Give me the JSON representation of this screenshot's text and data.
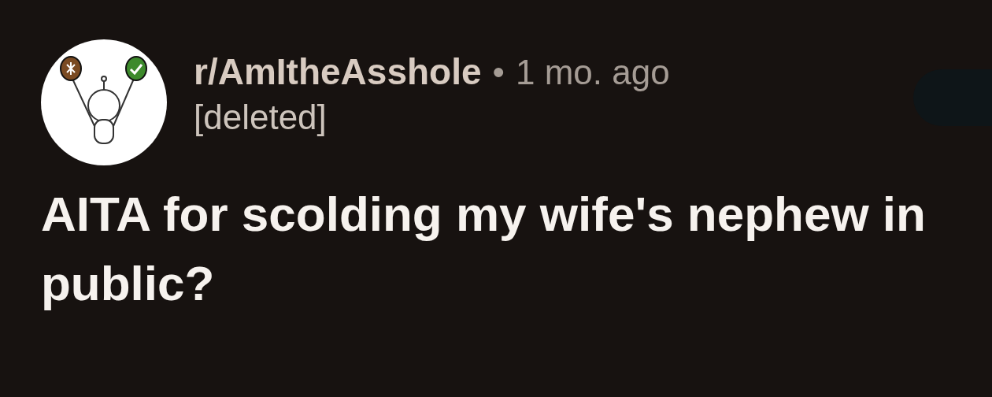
{
  "post": {
    "subreddit": "r/AmItheAsshole",
    "separator": "•",
    "age": "1 mo. ago",
    "author": "[deleted]",
    "title": "AITA for scolding my wife's nephew in public?"
  }
}
